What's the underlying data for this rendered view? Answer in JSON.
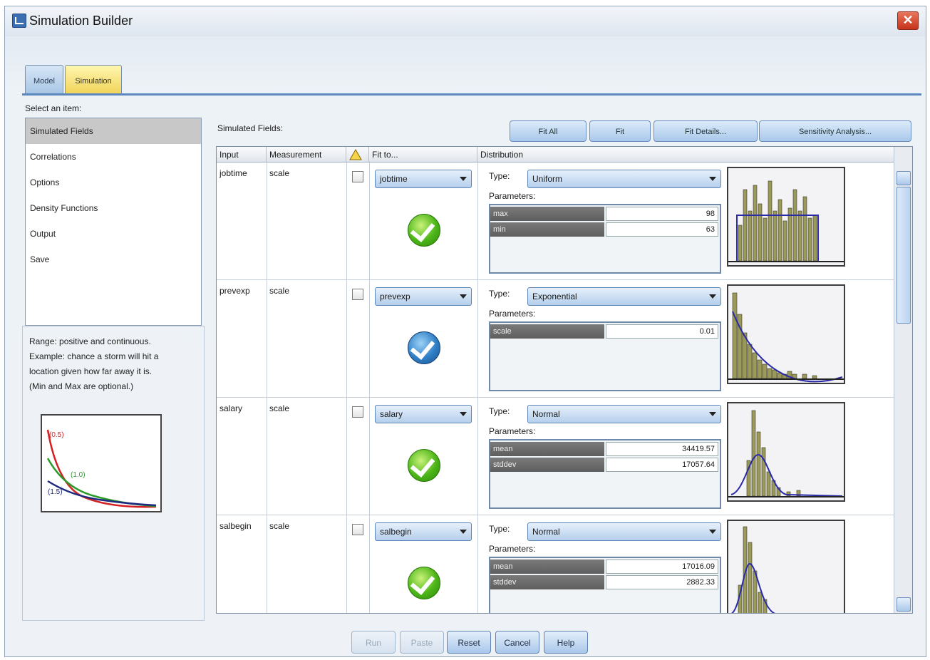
{
  "window": {
    "title": "Simulation Builder",
    "close_glyph": "✕"
  },
  "tabs": [
    {
      "label": "Model"
    },
    {
      "label": "Simulation"
    }
  ],
  "select_label": "Select an item:",
  "nav": [
    {
      "label": "Simulated Fields"
    },
    {
      "label": "Correlations"
    },
    {
      "label": "Options"
    },
    {
      "label": "Density Functions"
    },
    {
      "label": "Output"
    },
    {
      "label": "Save"
    }
  ],
  "description": {
    "line1": "Range: positive and continuous.",
    "line2": "Example: chance a storm will hit a",
    "line3": "location given how far away it is.",
    "line4": "(Min and Max are optional.)"
  },
  "mini_chart": {
    "labels": [
      "(0.5)",
      "(1.0)",
      "(1.5)"
    ],
    "colors": [
      "#d42020",
      "#2a9a2a",
      "#1e2a80"
    ]
  },
  "simulated_fields_label": "Simulated Fields:",
  "toolbar": {
    "fit_all": "Fit All",
    "fit": "Fit",
    "fit_details": "Fit Details...",
    "sensitivity": "Sensitivity Analysis..."
  },
  "grid_headers": {
    "input": "Input",
    "measurement": "Measurement",
    "fit_to": "Fit to...",
    "distribution": "Distribution"
  },
  "type_label": "Type:",
  "params_label": "Parameters:",
  "rows": [
    {
      "input": "jobtime",
      "measurement": "scale",
      "fit_to": "jobtime",
      "status": "green",
      "type": "Uniform",
      "params": [
        {
          "name": "max",
          "value": "98"
        },
        {
          "name": "min",
          "value": "63"
        }
      ]
    },
    {
      "input": "prevexp",
      "measurement": "scale",
      "fit_to": "prevexp",
      "status": "blue",
      "type": "Exponential",
      "params": [
        {
          "name": "scale",
          "value": "0.01"
        }
      ]
    },
    {
      "input": "salary",
      "measurement": "scale",
      "fit_to": "salary",
      "status": "green",
      "type": "Normal",
      "params": [
        {
          "name": "mean",
          "value": "34419.57"
        },
        {
          "name": "stddev",
          "value": "17057.64"
        }
      ]
    },
    {
      "input": "salbegin",
      "measurement": "scale",
      "fit_to": "salbegin",
      "status": "green",
      "type": "Normal",
      "params": [
        {
          "name": "mean",
          "value": "17016.09"
        },
        {
          "name": "stddev",
          "value": "2882.33"
        }
      ]
    }
  ],
  "buttons": {
    "run": "Run",
    "paste": "Paste",
    "reset": "Reset",
    "cancel": "Cancel",
    "help": "Help"
  },
  "colors": {
    "accent": "#5b88bf",
    "simulation_tab": "#f0d45a",
    "hist_bar": "#9c9a5a",
    "hist_curve": "#2a2aa8"
  }
}
